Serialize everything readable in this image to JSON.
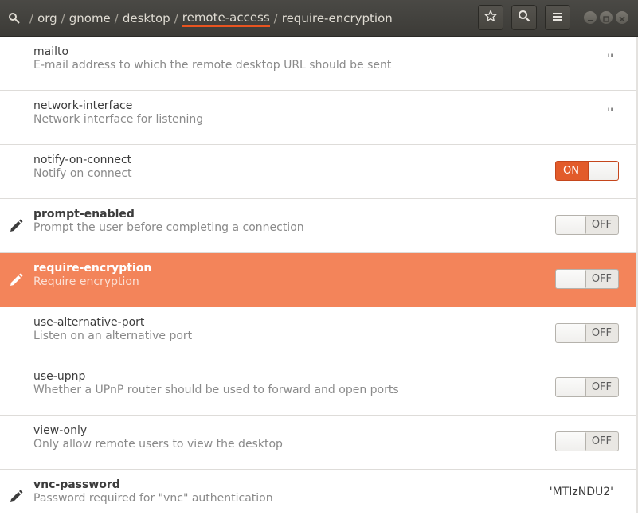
{
  "breadcrumb": {
    "items": [
      "org",
      "gnome",
      "desktop",
      "remote-access",
      "require-encryption"
    ],
    "active_index": 3
  },
  "header": {
    "bookmark_icon": "star-icon",
    "search_icon": "search-icon",
    "menu_icon": "hamburger-menu-icon"
  },
  "colors": {
    "accent": "#e95420",
    "selected_row": "#f3845a",
    "header_bg": "#3c3b37"
  },
  "keys": [
    {
      "name": "mailto",
      "desc": "E-mail address to which the remote desktop URL should be sent",
      "value": "''",
      "kind": "text",
      "modified": false,
      "selected": false
    },
    {
      "name": "network-interface",
      "desc": "Network interface for listening",
      "value": "''",
      "kind": "text",
      "modified": false,
      "selected": false
    },
    {
      "name": "notify-on-connect",
      "desc": "Notify on connect",
      "value": "ON",
      "kind": "toggle",
      "on": true,
      "modified": false,
      "selected": false
    },
    {
      "name": "prompt-enabled",
      "desc": "Prompt the user before completing a connection",
      "value": "OFF",
      "kind": "toggle",
      "on": false,
      "modified": true,
      "selected": false
    },
    {
      "name": "require-encryption",
      "desc": "Require encryption",
      "value": "OFF",
      "kind": "toggle",
      "on": false,
      "modified": true,
      "selected": true
    },
    {
      "name": "use-alternative-port",
      "desc": "Listen on an alternative port",
      "value": "OFF",
      "kind": "toggle",
      "on": false,
      "modified": false,
      "selected": false
    },
    {
      "name": "use-upnp",
      "desc": "Whether a UPnP router should be used to forward and open ports",
      "value": "OFF",
      "kind": "toggle",
      "on": false,
      "modified": false,
      "selected": false
    },
    {
      "name": "view-only",
      "desc": "Only allow remote users to view the desktop",
      "value": "OFF",
      "kind": "toggle",
      "on": false,
      "modified": false,
      "selected": false
    },
    {
      "name": "vnc-password",
      "desc": "Password required for \"vnc\" authentication",
      "value": "'MTIzNDU2'",
      "kind": "text",
      "modified": true,
      "selected": false
    }
  ]
}
